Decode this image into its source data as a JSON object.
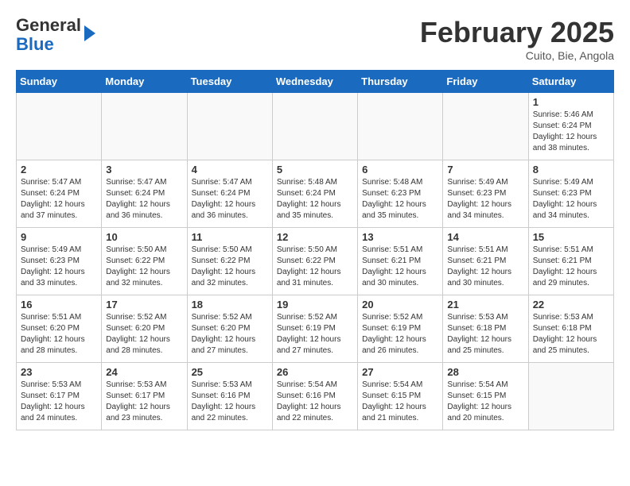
{
  "header": {
    "logo_line1": "General",
    "logo_line2": "Blue",
    "title": "February 2025",
    "subtitle": "Cuito, Bie, Angola"
  },
  "days_of_week": [
    "Sunday",
    "Monday",
    "Tuesday",
    "Wednesday",
    "Thursday",
    "Friday",
    "Saturday"
  ],
  "weeks": [
    [
      {
        "day": "",
        "info": ""
      },
      {
        "day": "",
        "info": ""
      },
      {
        "day": "",
        "info": ""
      },
      {
        "day": "",
        "info": ""
      },
      {
        "day": "",
        "info": ""
      },
      {
        "day": "",
        "info": ""
      },
      {
        "day": "1",
        "info": "Sunrise: 5:46 AM\nSunset: 6:24 PM\nDaylight: 12 hours\nand 38 minutes."
      }
    ],
    [
      {
        "day": "2",
        "info": "Sunrise: 5:47 AM\nSunset: 6:24 PM\nDaylight: 12 hours\nand 37 minutes."
      },
      {
        "day": "3",
        "info": "Sunrise: 5:47 AM\nSunset: 6:24 PM\nDaylight: 12 hours\nand 36 minutes."
      },
      {
        "day": "4",
        "info": "Sunrise: 5:47 AM\nSunset: 6:24 PM\nDaylight: 12 hours\nand 36 minutes."
      },
      {
        "day": "5",
        "info": "Sunrise: 5:48 AM\nSunset: 6:24 PM\nDaylight: 12 hours\nand 35 minutes."
      },
      {
        "day": "6",
        "info": "Sunrise: 5:48 AM\nSunset: 6:23 PM\nDaylight: 12 hours\nand 35 minutes."
      },
      {
        "day": "7",
        "info": "Sunrise: 5:49 AM\nSunset: 6:23 PM\nDaylight: 12 hours\nand 34 minutes."
      },
      {
        "day": "8",
        "info": "Sunrise: 5:49 AM\nSunset: 6:23 PM\nDaylight: 12 hours\nand 34 minutes."
      }
    ],
    [
      {
        "day": "9",
        "info": "Sunrise: 5:49 AM\nSunset: 6:23 PM\nDaylight: 12 hours\nand 33 minutes."
      },
      {
        "day": "10",
        "info": "Sunrise: 5:50 AM\nSunset: 6:22 PM\nDaylight: 12 hours\nand 32 minutes."
      },
      {
        "day": "11",
        "info": "Sunrise: 5:50 AM\nSunset: 6:22 PM\nDaylight: 12 hours\nand 32 minutes."
      },
      {
        "day": "12",
        "info": "Sunrise: 5:50 AM\nSunset: 6:22 PM\nDaylight: 12 hours\nand 31 minutes."
      },
      {
        "day": "13",
        "info": "Sunrise: 5:51 AM\nSunset: 6:21 PM\nDaylight: 12 hours\nand 30 minutes."
      },
      {
        "day": "14",
        "info": "Sunrise: 5:51 AM\nSunset: 6:21 PM\nDaylight: 12 hours\nand 30 minutes."
      },
      {
        "day": "15",
        "info": "Sunrise: 5:51 AM\nSunset: 6:21 PM\nDaylight: 12 hours\nand 29 minutes."
      }
    ],
    [
      {
        "day": "16",
        "info": "Sunrise: 5:51 AM\nSunset: 6:20 PM\nDaylight: 12 hours\nand 28 minutes."
      },
      {
        "day": "17",
        "info": "Sunrise: 5:52 AM\nSunset: 6:20 PM\nDaylight: 12 hours\nand 28 minutes."
      },
      {
        "day": "18",
        "info": "Sunrise: 5:52 AM\nSunset: 6:20 PM\nDaylight: 12 hours\nand 27 minutes."
      },
      {
        "day": "19",
        "info": "Sunrise: 5:52 AM\nSunset: 6:19 PM\nDaylight: 12 hours\nand 27 minutes."
      },
      {
        "day": "20",
        "info": "Sunrise: 5:52 AM\nSunset: 6:19 PM\nDaylight: 12 hours\nand 26 minutes."
      },
      {
        "day": "21",
        "info": "Sunrise: 5:53 AM\nSunset: 6:18 PM\nDaylight: 12 hours\nand 25 minutes."
      },
      {
        "day": "22",
        "info": "Sunrise: 5:53 AM\nSunset: 6:18 PM\nDaylight: 12 hours\nand 25 minutes."
      }
    ],
    [
      {
        "day": "23",
        "info": "Sunrise: 5:53 AM\nSunset: 6:17 PM\nDaylight: 12 hours\nand 24 minutes."
      },
      {
        "day": "24",
        "info": "Sunrise: 5:53 AM\nSunset: 6:17 PM\nDaylight: 12 hours\nand 23 minutes."
      },
      {
        "day": "25",
        "info": "Sunrise: 5:53 AM\nSunset: 6:16 PM\nDaylight: 12 hours\nand 22 minutes."
      },
      {
        "day": "26",
        "info": "Sunrise: 5:54 AM\nSunset: 6:16 PM\nDaylight: 12 hours\nand 22 minutes."
      },
      {
        "day": "27",
        "info": "Sunrise: 5:54 AM\nSunset: 6:15 PM\nDaylight: 12 hours\nand 21 minutes."
      },
      {
        "day": "28",
        "info": "Sunrise: 5:54 AM\nSunset: 6:15 PM\nDaylight: 12 hours\nand 20 minutes."
      },
      {
        "day": "",
        "info": ""
      }
    ]
  ]
}
